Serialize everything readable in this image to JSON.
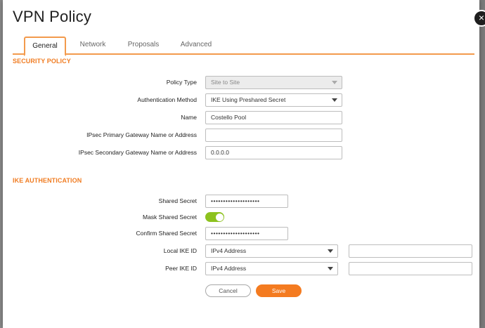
{
  "dialog": {
    "title": "VPN Policy",
    "close_glyph": "×",
    "tabs": [
      {
        "label": "General",
        "active": true
      },
      {
        "label": "Network",
        "active": false
      },
      {
        "label": "Proposals",
        "active": false
      },
      {
        "label": "Advanced",
        "active": false
      }
    ]
  },
  "security_policy": {
    "heading": "SECURITY POLICY",
    "policy_type": {
      "label": "Policy Type",
      "value": "Site to Site",
      "disabled": true
    },
    "auth_method": {
      "label": "Authentication Method",
      "value": "IKE Using Preshared Secret"
    },
    "name": {
      "label": "Name",
      "value": "Costello Pool"
    },
    "primary_gateway": {
      "label": "IPsec Primary Gateway Name or Address",
      "value": ""
    },
    "secondary_gateway": {
      "label": "IPsec Secondary Gateway Name or Address",
      "value": "0.0.0.0"
    }
  },
  "ike_auth": {
    "heading": "IKE AUTHENTICATION",
    "shared_secret": {
      "label": "Shared Secret",
      "value": "••••••••••••••••••••"
    },
    "mask_shared_secret": {
      "label": "Mask Shared Secret",
      "on": true
    },
    "confirm_shared_secret": {
      "label": "Confirm Shared Secret",
      "value": "••••••••••••••••••••"
    },
    "local_ike_id": {
      "label": "Local IKE ID",
      "type_value": "IPv4 Address",
      "value": ""
    },
    "peer_ike_id": {
      "label": "Peer IKE ID",
      "type_value": "IPv4 Address",
      "value": ""
    }
  },
  "actions": {
    "cancel_label": "Cancel",
    "save_label": "Save"
  },
  "colors": {
    "accent": "#f07c22",
    "save_button": "#f47b20",
    "toggle_on": "#8dc21f"
  },
  "icons": {
    "close": "close-icon",
    "dropdown": "chevron-down-icon"
  }
}
